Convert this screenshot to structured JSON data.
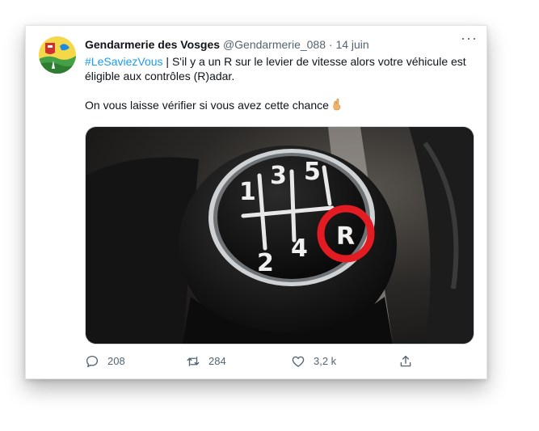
{
  "tweet": {
    "display_name": "Gendarmerie des Vosges",
    "handle": "@Gendarmerie_088",
    "separator": "·",
    "date": "14 juin",
    "more_label": "···",
    "hashtag": "#LeSaviezVous",
    "text_line1_rest": " | S'il y a un R sur le levier de vitesse alors votre véhicule est éligible aux contrôles (R)adar.",
    "text_line2": "On vous laisse vérifier si vous avez cette chance",
    "media": {
      "knob_numbers": [
        "1",
        "3",
        "5",
        "2",
        "4",
        "R"
      ],
      "highlight_color": "#e31b23"
    },
    "actions": {
      "replies": "208",
      "retweets": "284",
      "likes": "3,2 k"
    }
  },
  "colors": {
    "accent": "#1d9bf0",
    "muted": "#536471",
    "text": "#0f1419"
  }
}
